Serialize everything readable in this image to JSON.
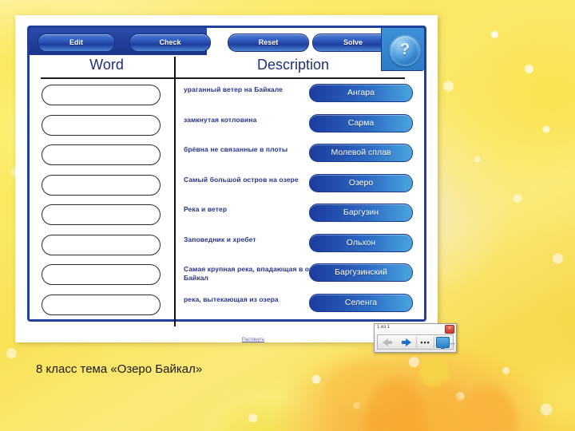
{
  "slide": {
    "caption": "8 класс тема «Озеро Байкал»"
  },
  "app": {
    "toolbar": {
      "edit_label": "Edit",
      "check_label": "Check",
      "reset_label": "Reset",
      "solve_label": "Solve",
      "help_label": "?"
    },
    "headers": {
      "word": "Word",
      "description": "Description"
    },
    "rows": [
      {
        "word_value": "",
        "description": "ураганный ветер на Байкале",
        "answer": "Ангара"
      },
      {
        "word_value": "",
        "description": "замкнутая котловина",
        "answer": "Сарма"
      },
      {
        "word_value": "",
        "description": "брёвна не связанные в плоты",
        "answer": "Молевой сплав"
      },
      {
        "word_value": "",
        "description": "Самый большой остров на озере",
        "answer": "Озеро"
      },
      {
        "word_value": "",
        "description": "Река и ветер",
        "answer": "Баргузин"
      },
      {
        "word_value": "",
        "description": "Заповедник и  хребет",
        "answer": "Ольхон"
      },
      {
        "word_value": "",
        "description": "Самая крупная река, впадающая в озеро Байкал",
        "answer": "Баргузинский"
      },
      {
        "word_value": "",
        "description": "река, вытекающая из озера",
        "answer": "Селенга"
      }
    ],
    "stretch_link": "Растянуть"
  },
  "nav_widget": {
    "counter": "1 из 1",
    "close_label": "×",
    "back_label": "back-arrow",
    "forward_label": "forward-arrow",
    "dots_label": "•••",
    "monitor_label": "monitor-icon",
    "expand_label": "↔"
  },
  "colors": {
    "frame_blue": "#21409a",
    "answer_blue": "#2553b2",
    "text_blue": "#26348c",
    "background_yellow": "#f9e255"
  }
}
